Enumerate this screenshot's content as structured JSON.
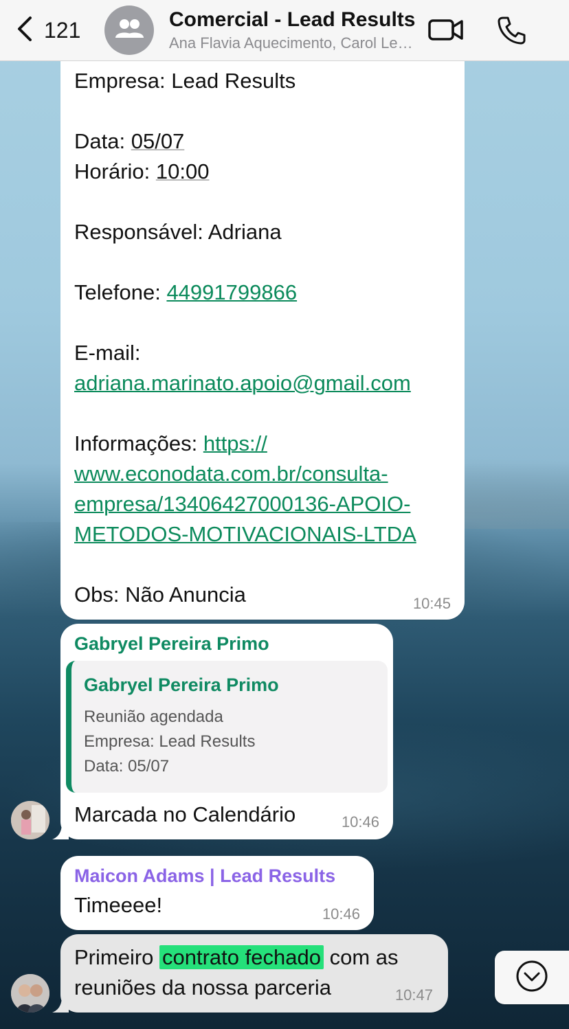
{
  "header": {
    "back_count": "121",
    "title": "Comercial - Lead Results",
    "subtitle": "Ana Flavia Aquecimento, Carol Lead Results"
  },
  "message1": {
    "line_empresa": "Empresa: Lead Results",
    "data_label": "Data: ",
    "data_value": "05/07",
    "horario_label": "Horário: ",
    "horario_value": "10:00",
    "responsavel": "Responsável: Adriana",
    "telefone_label": "Telefone: ",
    "telefone_value": "44991799866",
    "email_label": "E-mail:",
    "email_value": "adriana.marinato.apoio@gmail.com",
    "info_label": "Informações: ",
    "info_link_1": "https://",
    "info_link_2": "www.econodata.com.br/consulta-",
    "info_link_3": "empresa/13406427000136-APOIO-",
    "info_link_4": "METODOS-MOTIVACIONAIS-LTDA",
    "obs": "Obs: Não Anuncia",
    "time": "10:45"
  },
  "message2": {
    "sender": "Gabryel Pereira Primo",
    "quote_sender": "Gabryel Pereira Primo",
    "quote_lines": [
      "Reunião agendada",
      "Empresa: Lead Results",
      "Data: 05/07"
    ],
    "text": "Marcada no Calendário",
    "time": "10:46"
  },
  "message3": {
    "sender": "Maicon Adams | Lead Results",
    "text": "Timeeee!",
    "time": "10:46"
  },
  "message4": {
    "text_before": "Primeiro ",
    "highlight": "contrato fechado",
    "text_after": " com as",
    "line2": "reuniões da nossa parceria",
    "time": "10:47"
  },
  "colors": {
    "link_green": "#0b8a5b",
    "sender_green": "#0f8a62",
    "sender_purple": "#8a63e6",
    "highlight": "#25e07a"
  },
  "icons": [
    "back-chevron-icon",
    "group-icon",
    "video-call-icon",
    "phone-icon",
    "scroll-down-icon"
  ]
}
